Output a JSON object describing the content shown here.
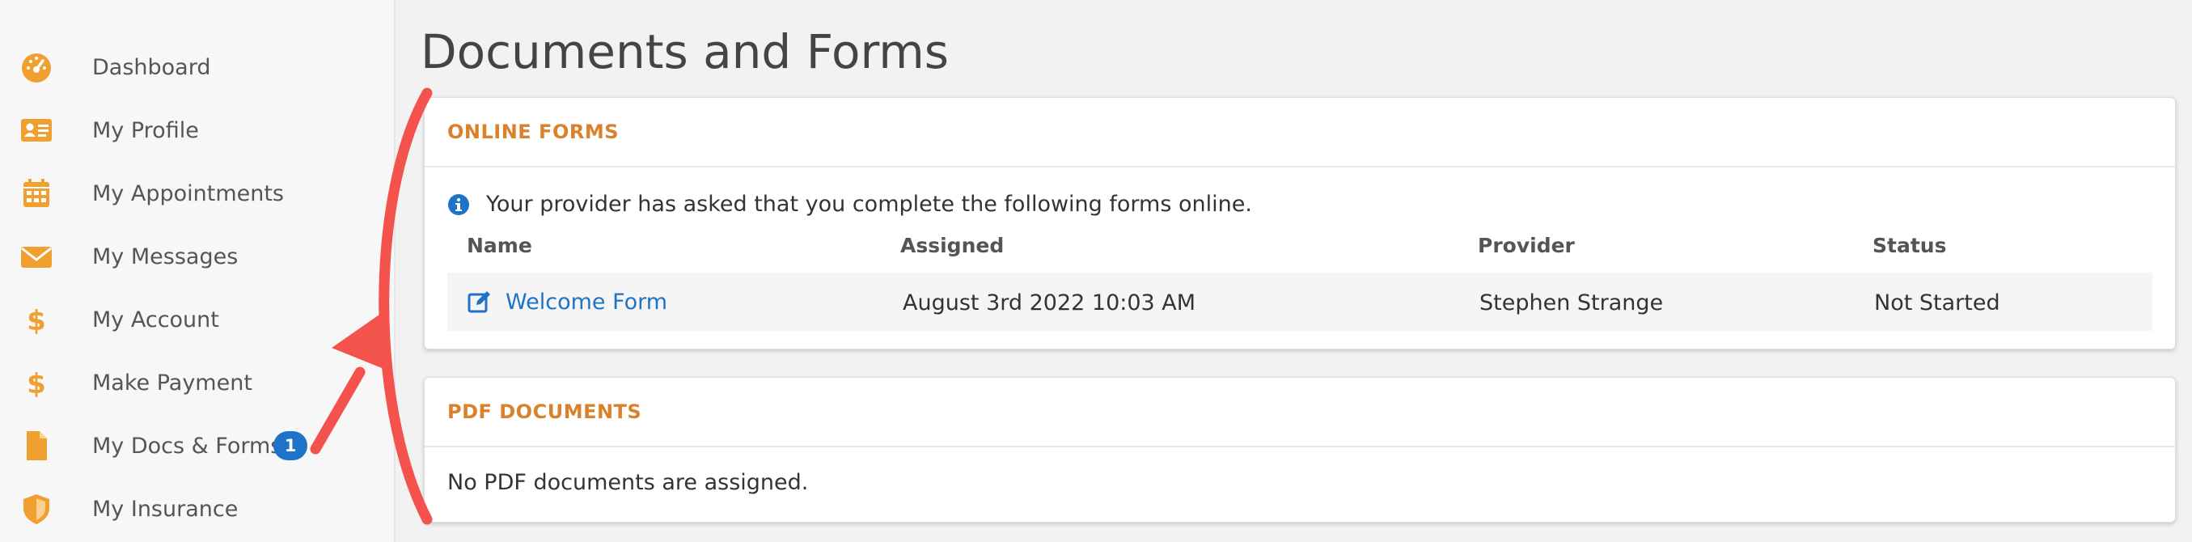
{
  "sidebar": {
    "items": [
      {
        "label": "Dashboard",
        "icon": "dashboard-gauge-icon"
      },
      {
        "label": "My Profile",
        "icon": "id-card-icon"
      },
      {
        "label": "My Appointments",
        "icon": "calendar-icon"
      },
      {
        "label": "My Messages",
        "icon": "envelope-icon"
      },
      {
        "label": "My Account",
        "icon": "dollar-icon"
      },
      {
        "label": "Make Payment",
        "icon": "dollar-icon"
      },
      {
        "label": "My Docs & Forms",
        "icon": "document-icon",
        "badge": "1"
      },
      {
        "label": "My Insurance",
        "icon": "shield-icon"
      }
    ],
    "icon_color": "#f0a030",
    "badge_color": "#1e73c8"
  },
  "page": {
    "title": "Documents and Forms"
  },
  "online_forms": {
    "title": "ONLINE FORMS",
    "info_text": "Your provider has asked that you complete the following forms online.",
    "columns": [
      "Name",
      "Assigned",
      "Provider",
      "Status"
    ],
    "rows": [
      {
        "name": "Welcome Form",
        "assigned": "August 3rd 2022 10:03 AM",
        "provider": "Stephen Strange",
        "status": "Not Started"
      }
    ]
  },
  "pdf_documents": {
    "title": "PDF DOCUMENTS",
    "empty_text": "No PDF documents are assigned."
  },
  "annotation": {
    "color": "#f4524d"
  }
}
